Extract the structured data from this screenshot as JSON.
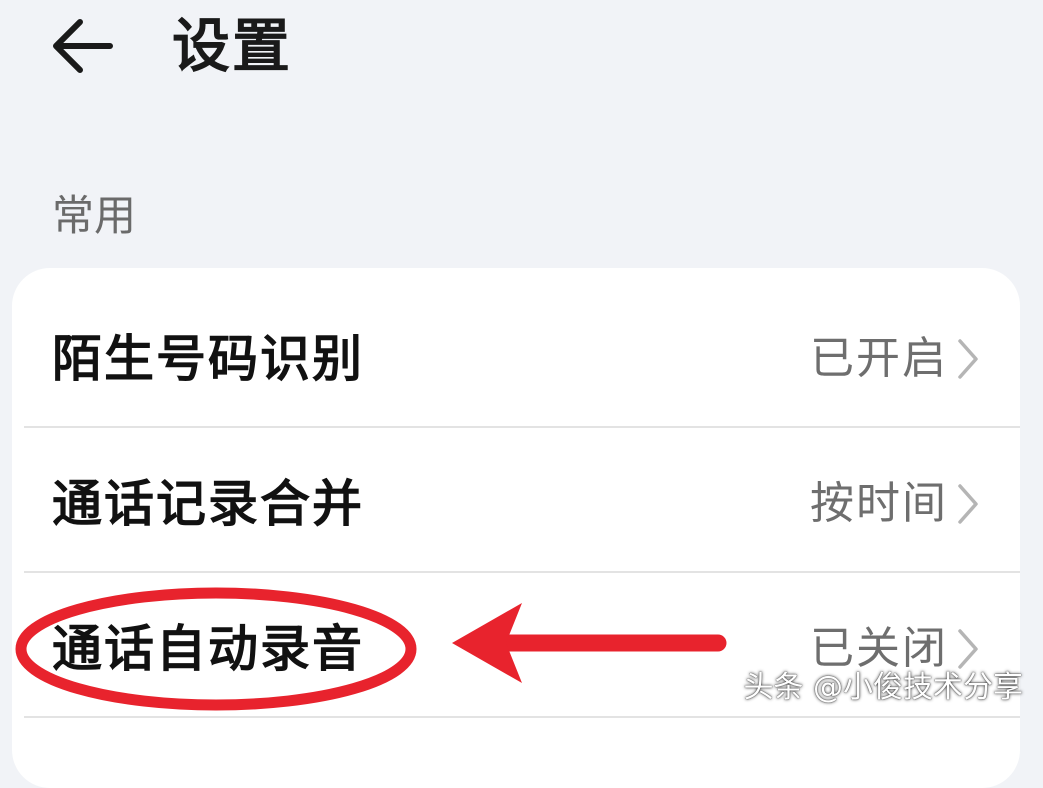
{
  "header": {
    "back_icon": "arrow-left-icon",
    "title": "设置"
  },
  "section": {
    "label": "常用"
  },
  "settings": [
    {
      "label": "陌生号码识别",
      "value": "已开启",
      "icon": "chevron-right-icon"
    },
    {
      "label": "通话记录合并",
      "value": "按时间",
      "icon": "chevron-right-icon"
    },
    {
      "label": "通话自动录音",
      "value": "已关闭",
      "icon": "chevron-right-icon"
    }
  ],
  "annotation": {
    "color": "#e8232d",
    "highlighted_item": "通话自动录音"
  },
  "watermark": {
    "text": "头条 @小俊技术分享"
  },
  "colors": {
    "background": "#f1f3f7",
    "card": "#ffffff",
    "title_text": "#1a1a1a",
    "value_text": "#6e6e6e",
    "chevron": "#b5b5b5"
  }
}
